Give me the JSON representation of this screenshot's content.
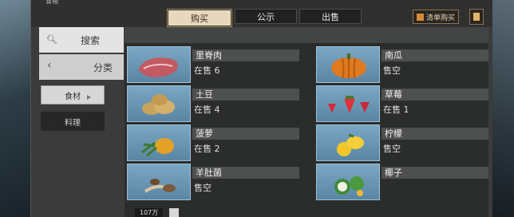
{
  "window": {
    "corner_title": "食物"
  },
  "tabs": [
    {
      "label": "购买",
      "active": true
    },
    {
      "label": "公示",
      "active": false
    },
    {
      "label": "出售",
      "active": false
    }
  ],
  "toolbar": {
    "list_buy_label": "清单购买",
    "list_icon": "shop-icon",
    "doc_icon": "document-icon"
  },
  "sidebar": {
    "search_label": "搜索",
    "category_label": "分类",
    "sub_categories": [
      {
        "label": "食材",
        "active": true
      },
      {
        "label": "料理",
        "active": false
      }
    ]
  },
  "items": [
    {
      "name": "里脊肉",
      "status": "在售 6",
      "icon": "meat-icon"
    },
    {
      "name": "南瓜",
      "status": "售空",
      "icon": "pumpkin-icon"
    },
    {
      "name": "土豆",
      "status": "在售 4",
      "icon": "potato-icon"
    },
    {
      "name": "草莓",
      "status": "在售 1",
      "icon": "strawberry-icon"
    },
    {
      "name": "菠萝",
      "status": "在售 2",
      "icon": "pineapple-icon"
    },
    {
      "name": "柠檬",
      "status": "售空",
      "icon": "lemon-icon"
    },
    {
      "name": "羊肚菌",
      "status": "售空",
      "icon": "mushroom-icon"
    },
    {
      "name": "椰子",
      "status": "",
      "icon": "coconut-icon"
    }
  ],
  "bottom": {
    "currency": "107万"
  },
  "colors": {
    "tab_active_bg": "#e6d7bd",
    "thumb_bg": "#6b97b6",
    "panel_bg": "#3a3b3a"
  }
}
